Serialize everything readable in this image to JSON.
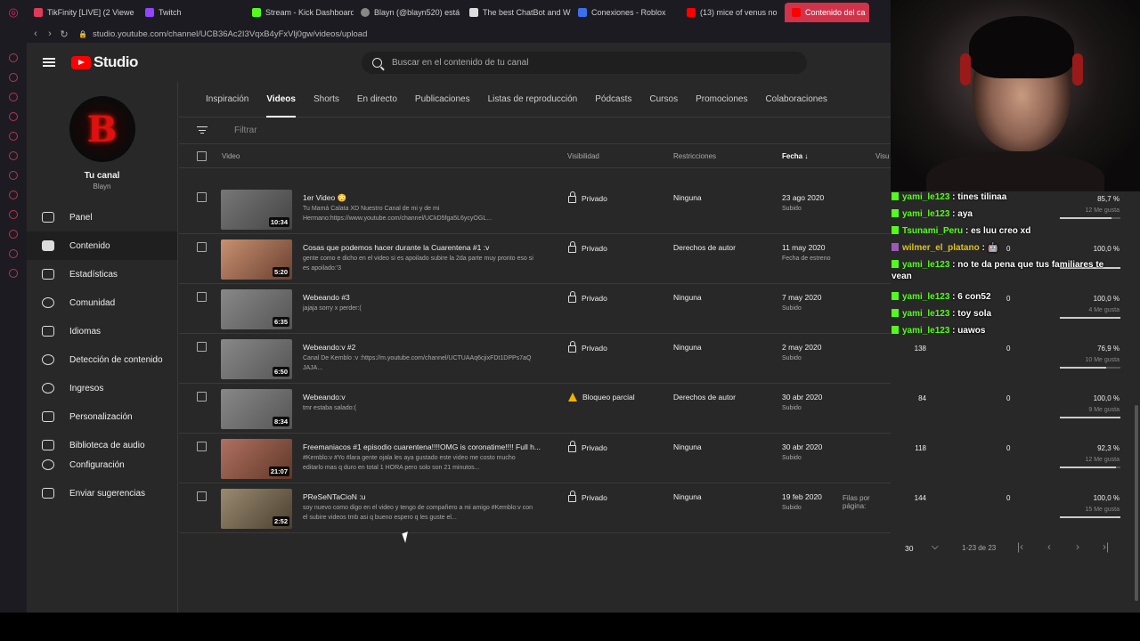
{
  "browser": {
    "tabs": [
      {
        "label": "TikFinity [LIVE] (2 Viewe",
        "color": "#e03a5a"
      },
      {
        "label": "Twitch",
        "color": "#9146ff"
      },
      {
        "label": "Stream - Kick Dashboard",
        "color": "#53fc18"
      },
      {
        "label": "Blayn (@blayn520) está",
        "color": "#888888"
      },
      {
        "label": "The best ChatBot and W",
        "color": "#dddddd"
      },
      {
        "label": "Conexiones - Roblox",
        "color": "#3a6ff0"
      },
      {
        "label": "(13) mice of venus no",
        "color": "#ff0000"
      },
      {
        "label": "Contenido del ca",
        "color": "#ff0000"
      }
    ],
    "url": "studio.youtube.com/channel/UCB36Ac2I3VqxB4yFxVlj0gw/videos/upload"
  },
  "studio": {
    "brand": "Studio",
    "search_placeholder": "Buscar en el contenido de tu canal",
    "channel_name": "Tu canal",
    "channel_handle": "Blayn",
    "avatar_letter": "B",
    "nav": [
      {
        "label": "Panel",
        "icon": "dashboard-icon"
      },
      {
        "label": "Contenido",
        "icon": "content-icon"
      },
      {
        "label": "Estadísticas",
        "icon": "analytics-icon"
      },
      {
        "label": "Comunidad",
        "icon": "community-icon"
      },
      {
        "label": "Idiomas",
        "icon": "subtitles-icon"
      },
      {
        "label": "Detección de contenido",
        "icon": "copyright-icon"
      },
      {
        "label": "Ingresos",
        "icon": "earn-icon"
      },
      {
        "label": "Personalización",
        "icon": "customize-icon"
      },
      {
        "label": "Biblioteca de audio",
        "icon": "audio-library-icon"
      }
    ],
    "bottom_nav": [
      {
        "label": "Configuración",
        "icon": "settings-icon"
      },
      {
        "label": "Enviar sugerencias",
        "icon": "feedback-icon"
      }
    ],
    "tabs": [
      "Inspiración",
      "Videos",
      "Shorts",
      "En directo",
      "Publicaciones",
      "Listas de reproducción",
      "Pódcasts",
      "Cursos",
      "Promociones",
      "Colaboraciones"
    ],
    "active_tab": "Videos",
    "filter_placeholder": "Filtrar",
    "columns": {
      "video": "Video",
      "visibility": "Visibilidad",
      "restrictions": "Restricciones",
      "date": "Fecha",
      "views": "Visu"
    },
    "videos": [
      {
        "title": "1er Video 😳",
        "desc": "Tu Mamá Calata XD Nuestro Canal de mi y de mi Hermano:https://www.youtube.com/channel/UCkD5fga5L6ycyOGL...",
        "duration": "10:34",
        "visibility": "Privado",
        "restriction": "Ninguna",
        "date": "23 ago 2020",
        "date_sub": "Subido"
      },
      {
        "title": "Cosas que podemos hacer durante la Cuarentena #1 :v",
        "desc": "gente como e dicho en el video si es apoilado subire la 2da parte muy pronto eso si es apoilado:'3",
        "duration": "5:20",
        "visibility": "Privado",
        "restriction": "Derechos de autor",
        "date": "11 may 2020",
        "date_sub": "Fecha de estreno"
      },
      {
        "title": "Webeando #3",
        "desc": "jajaja sorry x perder:(",
        "duration": "6:35",
        "visibility": "Privado",
        "restriction": "Ninguna",
        "date": "7 may 2020",
        "date_sub": "Subido"
      },
      {
        "title": "Webeando:v #2",
        "desc": "Canal De Kemblo :v :https://m.youtube.com/channel/UCTUAAq6cjixFDt1DPPs7aQ JAJA...",
        "duration": "6:50",
        "visibility": "Privado",
        "restriction": "Ninguna",
        "date": "2 may 2020",
        "date_sub": "Subido"
      },
      {
        "title": "Webeando:v",
        "desc": "tmr estaba salado:(",
        "duration": "8:34",
        "visibility": "Bloqueo parcial",
        "restriction": "Derechos de autor",
        "date": "30 abr 2020",
        "date_sub": "Subido"
      },
      {
        "title": "Freemaniacos #1 episodio cuarentena!!!!OMG is coronatime!!!! Full h...",
        "desc": "#Kemblo:v #Yo #lara gente ojala les aya gustado este video me costo mucho editarlo mas q duro en total 1 HORA pero solo son 21 minutos...",
        "duration": "21:07",
        "visibility": "Privado",
        "restriction": "Ninguna",
        "date": "30 abr 2020",
        "date_sub": "Subido"
      },
      {
        "title": "PReSeNTaCioN :u",
        "desc": "soy nuevo como digo en el video y tengo de compañero a mi amigo #Kemblo:v con el subire videos tmb asi q bueno espero q les guste el...",
        "duration": "2:52",
        "visibility": "Privado",
        "restriction": "Ninguna",
        "date": "19 feb 2020",
        "date_sub": "Subido"
      }
    ],
    "pager": {
      "rows_label": "Filas por página:",
      "rows_value": "30",
      "range": "1-23 de 23"
    }
  },
  "stats": [
    {
      "views": "",
      "comments": "",
      "likes_pct": "85,7 %",
      "likes": "12 Me gusta",
      "fraction": 0.857
    },
    {
      "views": "",
      "comments": "0",
      "likes_pct": "100,0 %",
      "likes": "",
      "fraction": 1.0
    },
    {
      "views": "",
      "comments": "0",
      "likes_pct": "100,0 %",
      "likes": "4 Me gusta",
      "fraction": 1.0
    },
    {
      "views": "138",
      "comments": "0",
      "likes_pct": "76,9 %",
      "likes": "10 Me gusta",
      "fraction": 0.769
    },
    {
      "views": "84",
      "comments": "0",
      "likes_pct": "100,0 %",
      "likes": "9 Me gusta",
      "fraction": 1.0
    },
    {
      "views": "118",
      "comments": "0",
      "likes_pct": "92,3 %",
      "likes": "12 Me gusta",
      "fraction": 0.923
    },
    {
      "views": "144",
      "comments": "0",
      "likes_pct": "100,0 %",
      "likes": "15 Me gusta",
      "fraction": 1.0
    }
  ],
  "chat": [
    {
      "user": "yami_le123",
      "text": "tines tilinaa",
      "badge": "kick"
    },
    {
      "user": "yami_le123",
      "text": "aya",
      "badge": "kick"
    },
    {
      "user": "Tsunami_Peru",
      "text": "es luu creo xd",
      "badge": "kick"
    },
    {
      "user": "wilmer_el_platano",
      "text": "🤖",
      "badge": "twitch"
    },
    {
      "user": "yami_le123",
      "text": "no te da pena que tus familiares te vean",
      "badge": "kick"
    },
    {
      "user": "yami_le123",
      "text": "6 con52",
      "badge": "kick"
    },
    {
      "user": "yami_le123",
      "text": "toy sola",
      "badge": "kick"
    },
    {
      "user": "yami_le123",
      "text": "uawos",
      "badge": "kick"
    }
  ]
}
